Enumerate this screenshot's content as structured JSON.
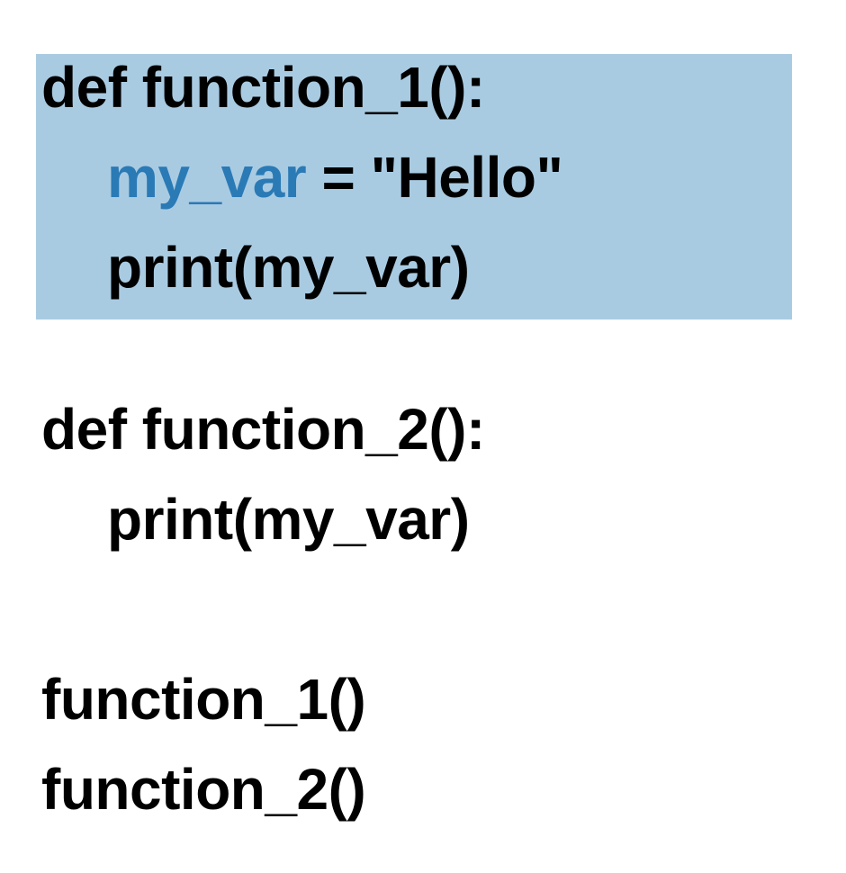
{
  "colors": {
    "highlight_background": "#a9cbe2",
    "variable_highlight": "#2a7ab6",
    "text": "#000000",
    "background": "#ffffff"
  },
  "code": {
    "function_1_def": "def function_1():",
    "assign_var": "my_var",
    "assign_rest": " = \"Hello\"",
    "function_1_print": "print(my_var)",
    "function_2_def": "def function_2():",
    "function_2_print": "print(my_var)",
    "call_1": "function_1()",
    "call_2": "function_2()"
  }
}
